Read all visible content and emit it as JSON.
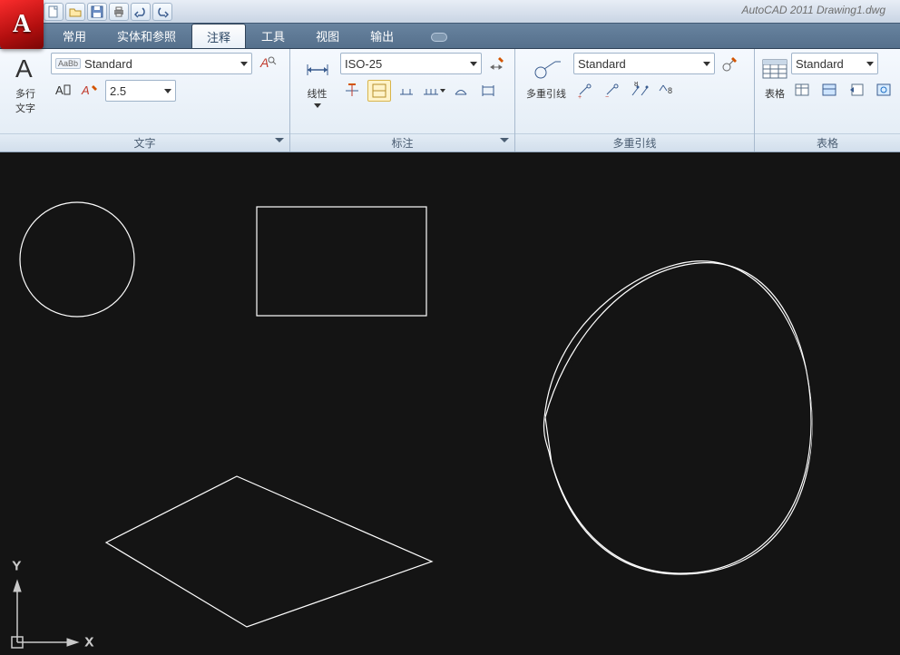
{
  "title_text": "AutoCAD 2011 Drawing1.dwg",
  "app_letter": "A",
  "tabs": {
    "items": [
      "常用",
      "实体和参照",
      "注释",
      "工具",
      "视图",
      "输出"
    ],
    "active_index": 2
  },
  "panel_text": {
    "big_label": "多行\n文字",
    "style_select": "Standard",
    "style_badge": "AaBb",
    "height_select": "2.5",
    "title": "文字"
  },
  "panel_dim": {
    "big_label": "线性",
    "style_select": "ISO-25",
    "title": "标注"
  },
  "panel_leader": {
    "big_label": "多重引线",
    "style_select": "Standard",
    "title": "多重引线"
  },
  "panel_table": {
    "big_label": "表格",
    "style_select": "Standard",
    "title": "表格"
  },
  "ucs": {
    "y": "Y",
    "x": "X"
  }
}
